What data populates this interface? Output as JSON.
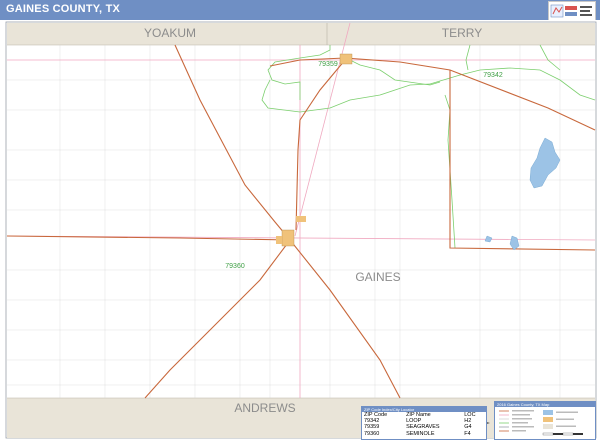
{
  "title": "GAINES COUNTY, TX",
  "labels": {
    "yoakum": "YOAKUM",
    "terry": "TERRY",
    "andrews": "ANDREWS",
    "gaines": "GAINES"
  },
  "zip_labels": {
    "z79359": "79359",
    "z79342": "79342",
    "z79360": "79360"
  },
  "zip_table": {
    "header": "ZIP Code Index/City Locator",
    "columns": [
      "ZIP Code",
      "ZIP Name",
      "LOC"
    ],
    "rows": [
      [
        "79342",
        "LOOP",
        "H2"
      ],
      [
        "79359",
        "SEAGRAVES",
        "G4"
      ],
      [
        "79360",
        "SEMINOLE",
        "F4"
      ]
    ]
  },
  "legend": {
    "header": "2016 Gaines County, TX Map"
  },
  "colors": {
    "title_bar": "#6f8fc4",
    "neighbor_band": "#e9e4d8",
    "zip_boundary": "#7ccf6e",
    "highway": "#c8683c",
    "pink_road": "#f0a9c0",
    "water": "#9cc3e6",
    "city": "#f0c27a"
  }
}
